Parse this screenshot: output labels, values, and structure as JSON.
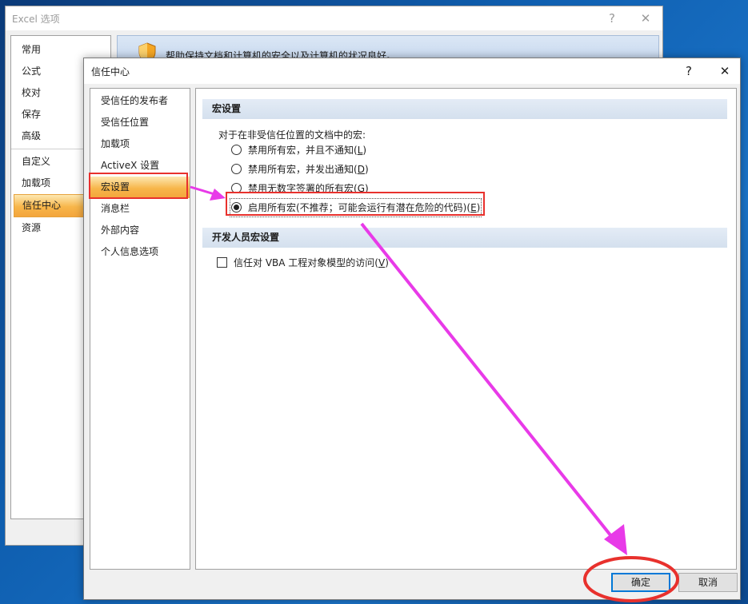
{
  "excel_options": {
    "title": "Excel 选项",
    "help_glyph": "?",
    "close_glyph": "✕",
    "nav_items_top": [
      "常用",
      "公式",
      "校对",
      "保存",
      "高级"
    ],
    "nav_items_bottom": [
      "自定义",
      "加载项",
      "信任中心",
      "资源"
    ],
    "selected": "信任中心",
    "banner_text": "帮助保持文档和计算机的安全以及计算机的状况良好。"
  },
  "trust_center": {
    "title": "信任中心",
    "help_glyph": "?",
    "close_glyph": "✕",
    "nav_items": [
      "受信任的发布者",
      "受信任位置",
      "加载项",
      "ActiveX 设置",
      "宏设置",
      "消息栏",
      "外部内容",
      "个人信息选项"
    ],
    "selected": "宏设置",
    "macro_section": {
      "header": "宏设置",
      "subtitle": "对于在非受信任位置的文档中的宏:",
      "options": [
        {
          "text": "禁用所有宏，并且不通知(",
          "key": "L",
          "suffix": ")",
          "checked": false
        },
        {
          "text": "禁用所有宏，并发出通知(",
          "key": "D",
          "suffix": ")",
          "checked": false
        },
        {
          "text": "禁用无数字签署的所有宏(",
          "key": "G",
          "suffix": ")",
          "checked": false
        },
        {
          "text": "启用所有宏(不推荐；可能会运行有潜在危险的代码)(",
          "key": "E",
          "suffix": ")",
          "checked": true
        }
      ]
    },
    "dev_section": {
      "header": "开发人员宏设置",
      "checkbox": {
        "text": "信任对 VBA 工程对象模型的访问(",
        "key": "V",
        "suffix": ")",
        "checked": false
      }
    },
    "ok_label": "确定",
    "cancel_label": "取消"
  },
  "colors": {
    "annotation_red": "#e8312d",
    "annotation_magenta": "#e83ae8",
    "selection_orange": "#f7b64a"
  }
}
